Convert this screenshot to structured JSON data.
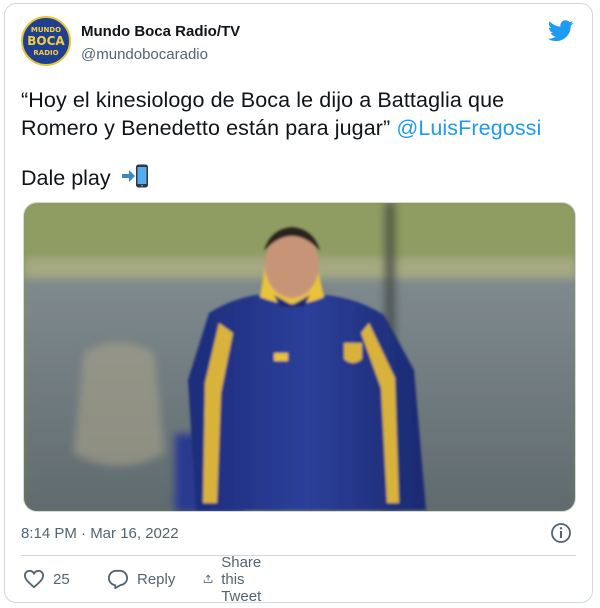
{
  "tweet": {
    "author_name": "Mundo Boca Radio/TV",
    "handle": "@mundobocaradio",
    "avatar_logo": {
      "line1": "MUNDO",
      "line2": "BOCA",
      "line3": "RADIO"
    },
    "text_line1": "“Hoy el kinesiologo de Boca le dijo a Battaglia que",
    "text_line2": "Romero y Benedetto están para jugar”",
    "mention": "@LuisFregossi",
    "second_paragraph": "Dale play",
    "emoji_icon": "phone-arrow-icon",
    "timestamp": "8:14 PM · Mar 16, 2022",
    "likes_count": "25",
    "reply_label": "Reply",
    "share_label": "Share this Tweet"
  },
  "colors": {
    "twitter_blue": "#1d9bf0",
    "text": "#0f1419",
    "muted": "#536471",
    "border": "#cfd9de"
  }
}
